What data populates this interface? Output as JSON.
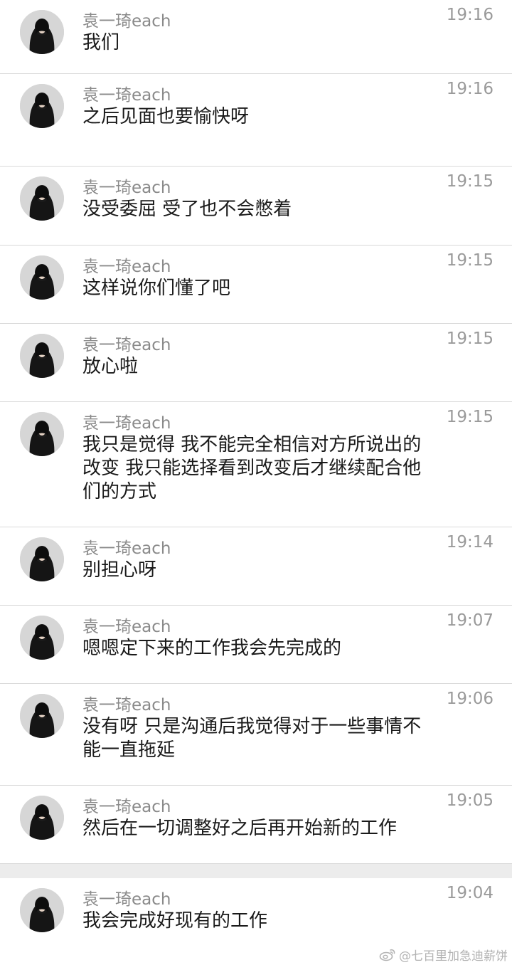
{
  "messages": [
    {
      "name": "袁一琦each",
      "time": "19:16",
      "text": "我们"
    },
    {
      "name": "袁一琦each",
      "time": "19:16",
      "text": "之后见面也要愉快呀"
    },
    {
      "name": "袁一琦each",
      "time": "19:15",
      "text": "没受委屈 受了也不会憋着"
    },
    {
      "name": "袁一琦each",
      "time": "19:15",
      "text": "这样说你们懂了吧"
    },
    {
      "name": "袁一琦each",
      "time": "19:15",
      "text": "放心啦"
    },
    {
      "name": "袁一琦each",
      "time": "19:15",
      "text": "我只是觉得 我不能完全相信对方所说出的改变 我只能选择看到改变后才继续配合他们的方式"
    },
    {
      "name": "袁一琦each",
      "time": "19:14",
      "text": "别担心呀"
    },
    {
      "name": "袁一琦each",
      "time": "19:07",
      "text": "嗯嗯定下来的工作我会先完成的"
    },
    {
      "name": "袁一琦each",
      "time": "19:06",
      "text": "没有呀 只是沟通后我觉得对于一些事情不能一直拖延"
    },
    {
      "name": "袁一琦each",
      "time": "19:05",
      "text": "然后在一切调整好之后再开始新的工作"
    },
    {
      "name": "袁一琦each",
      "time": "19:04",
      "text": "我会完成好现有的工作"
    }
  ],
  "watermark": {
    "icon": "weibo-icon",
    "text": "@七百里加急迪薪饼"
  },
  "colors": {
    "name_text": "#8a8a8a",
    "time_text": "#9a9a9a",
    "message_text": "#1a1a1a",
    "divider": "#d9d9d9",
    "section_gap": "#ececec"
  }
}
